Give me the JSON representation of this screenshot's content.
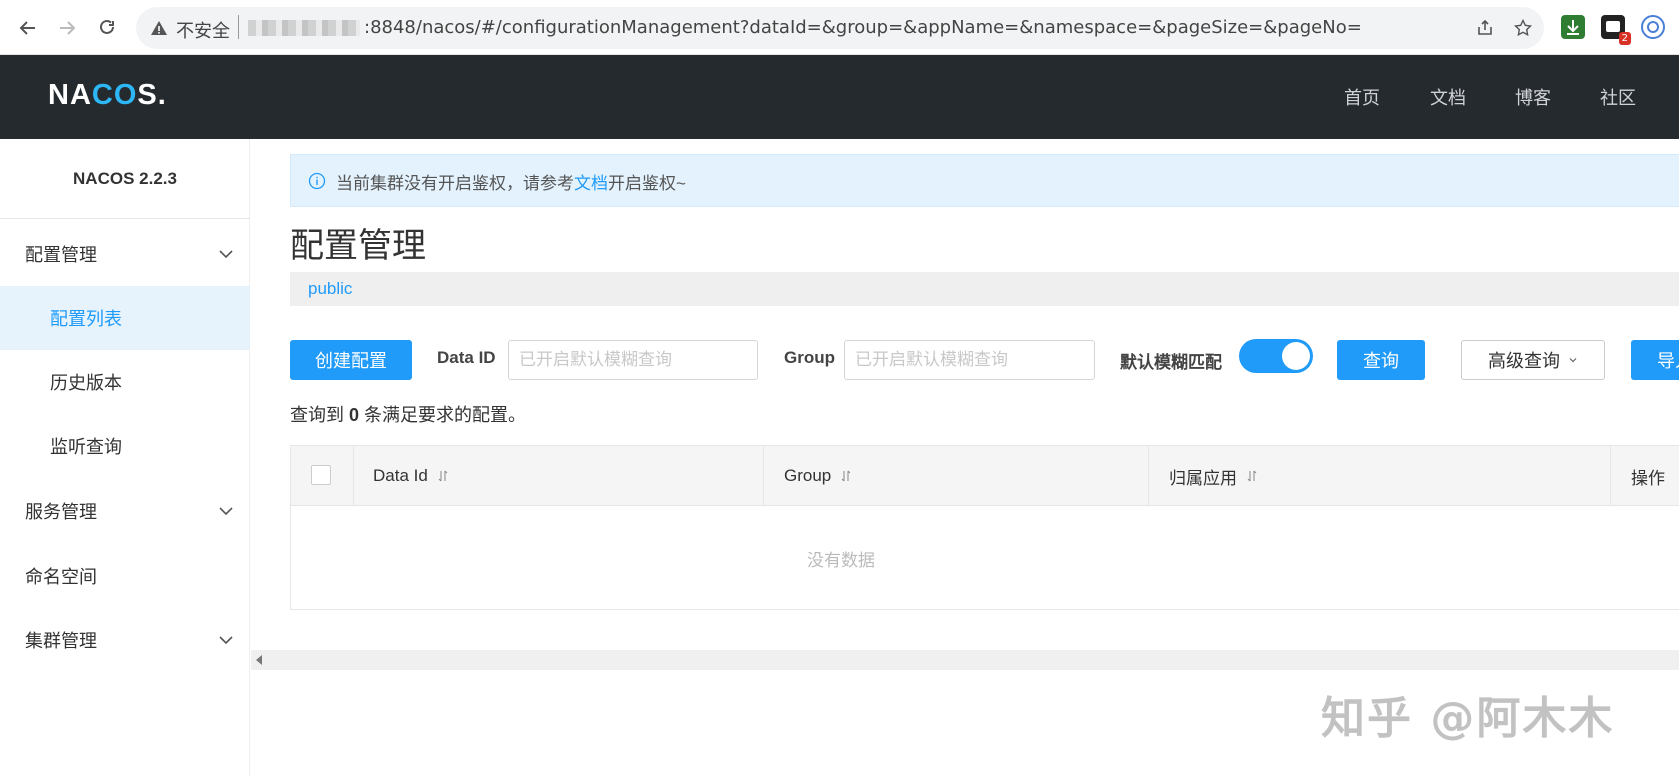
{
  "browser": {
    "insecure_label": "不安全",
    "url": ":8848/nacos/#/configurationManagement?dataId=&group=&appName=&namespace=&pageSize=&pageNo=",
    "extension_badge": "2"
  },
  "header": {
    "logo_pre": "NA",
    "logo_mid": "CO",
    "logo_post": "S.",
    "links": [
      "首页",
      "文档",
      "博客",
      "社区"
    ]
  },
  "sidebar": {
    "version": "NACOS 2.2.3",
    "items": [
      {
        "label": "配置管理"
      },
      {
        "label": "配置列表"
      },
      {
        "label": "历史版本"
      },
      {
        "label": "监听查询"
      },
      {
        "label": "服务管理"
      },
      {
        "label": "命名空间"
      },
      {
        "label": "集群管理"
      }
    ]
  },
  "notice": {
    "before": "当前集群没有开启鉴权，请参考",
    "link": "文档",
    "after": "开启鉴权~"
  },
  "page": {
    "title": "配置管理",
    "namespace": "public"
  },
  "toolbar": {
    "create_label": "创建配置",
    "data_id_label": "Data ID",
    "data_id_placeholder": "已开启默认模糊查询",
    "group_label": "Group",
    "group_placeholder": "已开启默认模糊查询",
    "fuzzy_label": "默认模糊匹配",
    "query_label": "查询",
    "advanced_label": "高级查询",
    "import_label": "导入"
  },
  "result": {
    "prefix": "查询到",
    "count": "0",
    "suffix": "条满足要求的配置。"
  },
  "table": {
    "columns": [
      "Data Id",
      "Group",
      "归属应用",
      "操作"
    ],
    "empty_text": "没有数据"
  },
  "watermark": "知乎 @阿木木",
  "colors": {
    "accent": "#209bfa",
    "header_bg": "#252a2f",
    "notice_bg": "#e3f2fd"
  }
}
